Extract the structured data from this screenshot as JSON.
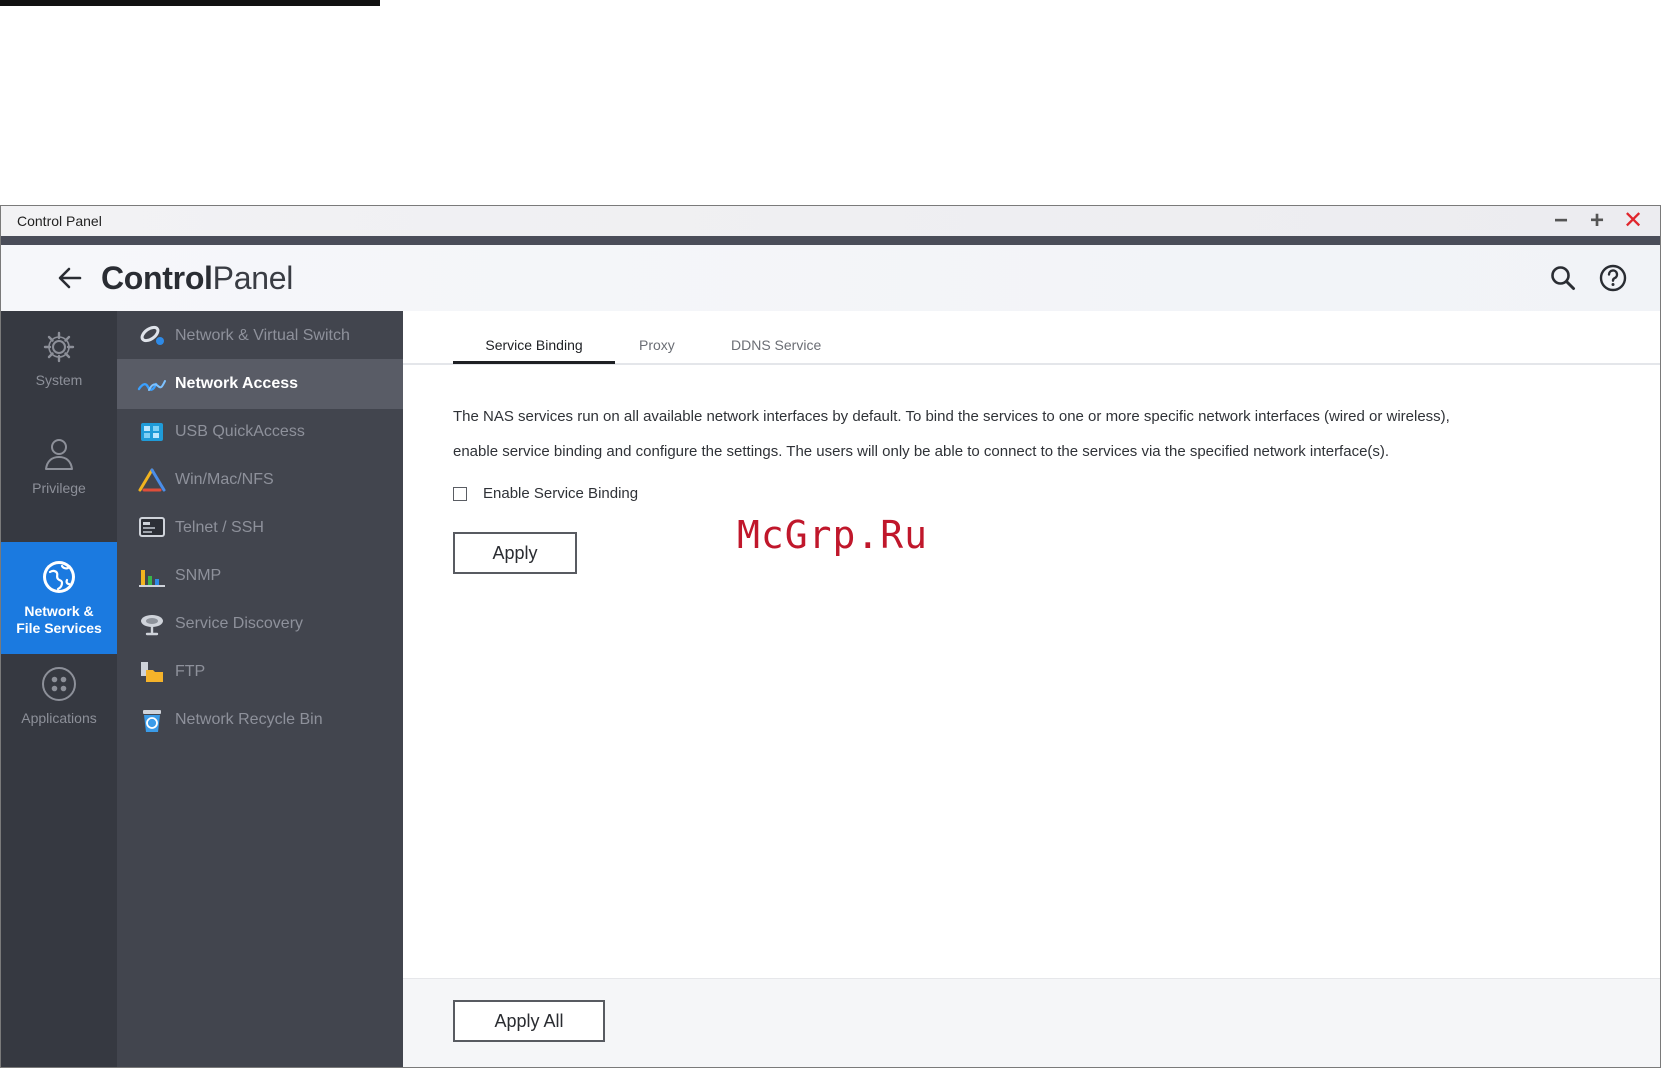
{
  "window": {
    "title": "Control Panel",
    "controls": {
      "minimize": "−",
      "maximize": "+",
      "close": "✕"
    }
  },
  "header": {
    "brand_bold": "Control",
    "brand_light": "Panel",
    "icons": [
      "search-icon",
      "help-icon"
    ]
  },
  "left_rail": {
    "items": [
      {
        "label": "System",
        "icon": "gear-icon",
        "active": false
      },
      {
        "label": "Privilege",
        "icon": "user-icon",
        "active": false
      },
      {
        "label_line1": "Network &",
        "label_line2": "File Services",
        "icon": "globe-icon",
        "active": true
      },
      {
        "label": "Applications",
        "icon": "apps-grid-icon",
        "active": false
      }
    ]
  },
  "sub_nav": {
    "items": [
      {
        "label": "Network & Virtual Switch",
        "icon": "network-switch-icon",
        "active": false
      },
      {
        "label": "Network Access",
        "icon": "network-access-icon",
        "active": true
      },
      {
        "label": "USB QuickAccess",
        "icon": "usb-icon",
        "active": false
      },
      {
        "label": "Win/Mac/NFS",
        "icon": "win-mac-nfs-icon",
        "active": false
      },
      {
        "label": "Telnet / SSH",
        "icon": "terminal-icon",
        "active": false
      },
      {
        "label": "SNMP",
        "icon": "snmp-chart-icon",
        "active": false
      },
      {
        "label": "Service Discovery",
        "icon": "service-discovery-icon",
        "active": false
      },
      {
        "label": "FTP",
        "icon": "ftp-folder-icon",
        "active": false
      },
      {
        "label": "Network Recycle Bin",
        "icon": "recycle-bin-icon",
        "active": false
      }
    ]
  },
  "tabs": [
    {
      "label": "Service Binding",
      "active": true
    },
    {
      "label": "Proxy",
      "active": false
    },
    {
      "label": "DDNS Service",
      "active": false
    }
  ],
  "service_binding": {
    "description_line1": "The NAS services run on all available network interfaces by default. To bind the services to one or more specific network interfaces (wired or wireless),",
    "description_line2": "enable service binding and configure the settings. The users will only be able to connect to the services via the specified network interface(s).",
    "checkbox_label": "Enable Service Binding",
    "checkbox_checked": false,
    "apply_label": "Apply"
  },
  "footer": {
    "apply_all_label": "Apply All"
  },
  "watermark": "McGrp.Ru",
  "colors": {
    "accent_blue": "#1b7ae0",
    "rail_bg": "#363941",
    "subnav_bg": "#42454e",
    "subnav_active": "#595c66",
    "close_red": "#e0262d",
    "watermark_red": "#c0172b"
  }
}
